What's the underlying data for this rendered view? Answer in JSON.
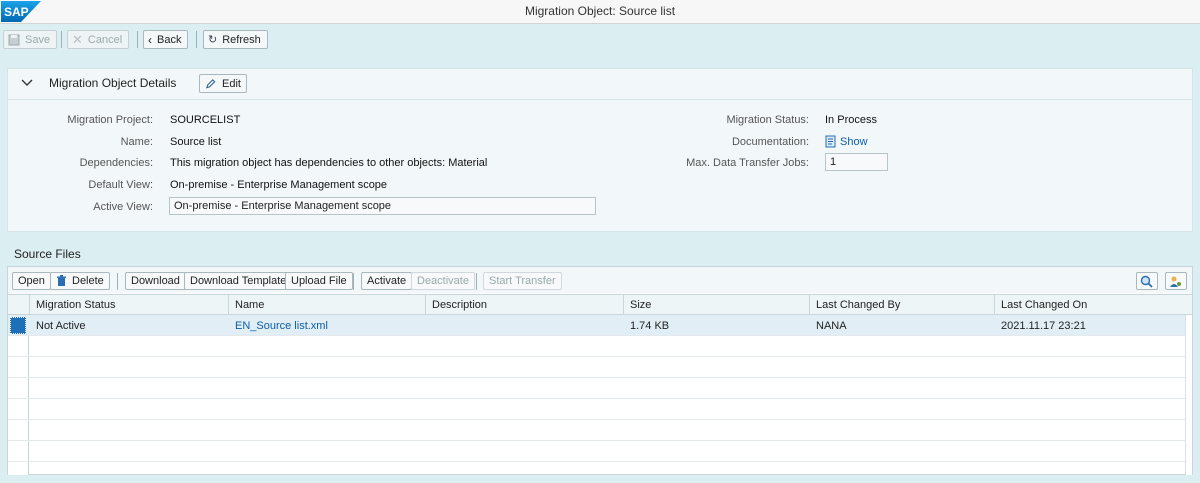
{
  "window": {
    "title": "Migration Object: Source list",
    "brand": "SAP"
  },
  "toolbar": {
    "save": "Save",
    "cancel": "Cancel",
    "back": "Back",
    "refresh": "Refresh"
  },
  "details": {
    "header": "Migration Object Details",
    "edit": "Edit",
    "fields": {
      "migration_project_label": "Migration Project:",
      "migration_project": "SOURCELIST",
      "name_label": "Name:",
      "name": "Source list",
      "dependencies_label": "Dependencies:",
      "dependencies": "This migration object has dependencies to other objects: Material",
      "default_view_label": "Default View:",
      "default_view": "On-premise - Enterprise Management scope",
      "active_view_label": "Active View:",
      "active_view": "On-premise - Enterprise Management scope",
      "migration_status_label": "Migration Status:",
      "migration_status": "In Process",
      "documentation_label": "Documentation:",
      "documentation": "Show",
      "max_jobs_label": "Max. Data Transfer Jobs:",
      "max_jobs": "1"
    }
  },
  "source_files": {
    "title": "Source Files",
    "buttons": {
      "open": "Open",
      "delete": "Delete",
      "download": "Download",
      "download_template": "Download Template",
      "upload_file": "Upload File",
      "activate": "Activate",
      "deactivate": "Deactivate",
      "start_transfer": "Start Transfer"
    },
    "columns": [
      "Migration Status",
      "Name",
      "Description",
      "Size",
      "Last Changed By",
      "Last Changed On"
    ],
    "rows": [
      {
        "status": "Not Active",
        "name": "EN_Source list.xml",
        "description": "",
        "size": "1.74 KB",
        "changed_by": "NANA",
        "changed_on": "2021.11.17 23:21"
      }
    ]
  },
  "colors": {
    "accent": "#0b5ea8",
    "highlight_underline": "#d40b0b",
    "selected_row": "#e1eef6",
    "brand_blue": "#0a6ed1"
  }
}
